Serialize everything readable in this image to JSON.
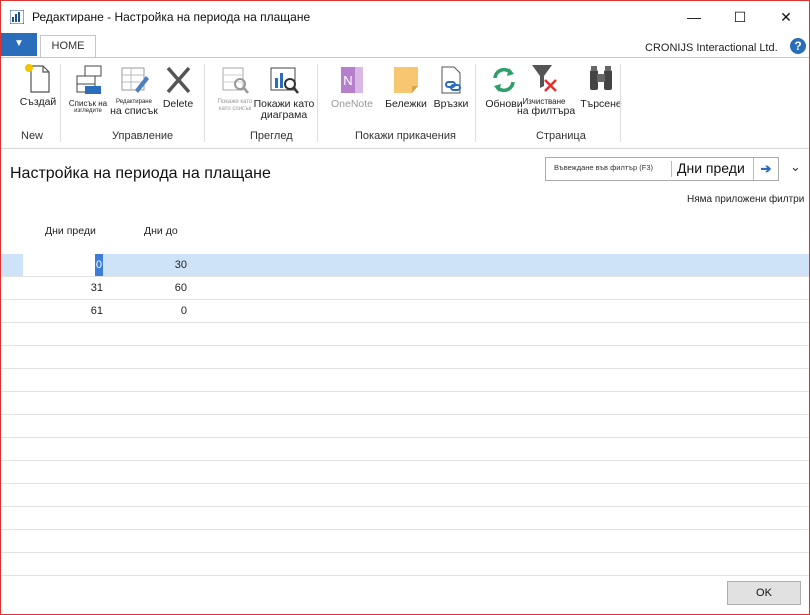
{
  "window": {
    "title": "Редактиране - Настройка на периода на плащане",
    "minimize_glyph": "—",
    "maximize_glyph": "☐",
    "close_glyph": "✕"
  },
  "ribbon_tabs": {
    "menu_arrow": "▼",
    "home": "HOME",
    "company": "CRONIJS Interactional Ltd.",
    "help_glyph": "?"
  },
  "ribbon": {
    "groups": {
      "new": "New",
      "manage": "Управление",
      "view": "Преглед",
      "attachments": "Покажи прикачения",
      "page": "Страница"
    },
    "buttons": {
      "create": "Създай",
      "list_views_1": "Списък на",
      "list_views_2": "изгледите",
      "edit_list_1": "Редактиране",
      "edit_list_2": "на списък",
      "delete": "Delete",
      "show_list_1": "Покажи като",
      "show_list_2": "като списък",
      "show_chart_1": "Покажи като",
      "show_chart_2": "диаграма",
      "onenote": "OneNote",
      "notes": "Бележки",
      "links": "Връзки",
      "refresh": "Обнови",
      "clear_filter_1": "Изчистване",
      "clear_filter_2": "на филтъра",
      "find": "Търсене"
    }
  },
  "page": {
    "title": "Настройка на периода на плащане",
    "filter_placeholder": "Въвеждане във филтър (F3)",
    "filter_field": "Дни преди",
    "go_glyph": "➔",
    "collapse_glyph": "⌄",
    "no_filters": "Няма приложени филтри"
  },
  "table": {
    "headers": [
      "Дни преди",
      "Дни до"
    ],
    "rows": [
      {
        "days_before": "0",
        "days_to": "30",
        "selected": true
      },
      {
        "days_before": "31",
        "days_to": "60",
        "selected": false
      },
      {
        "days_before": "61",
        "days_to": "0",
        "selected": false
      }
    ]
  },
  "footer": {
    "ok": "OK"
  },
  "colors": {
    "accent": "#2a6ebb",
    "selection": "#cfe3f8",
    "window_border": "#dd3333"
  }
}
